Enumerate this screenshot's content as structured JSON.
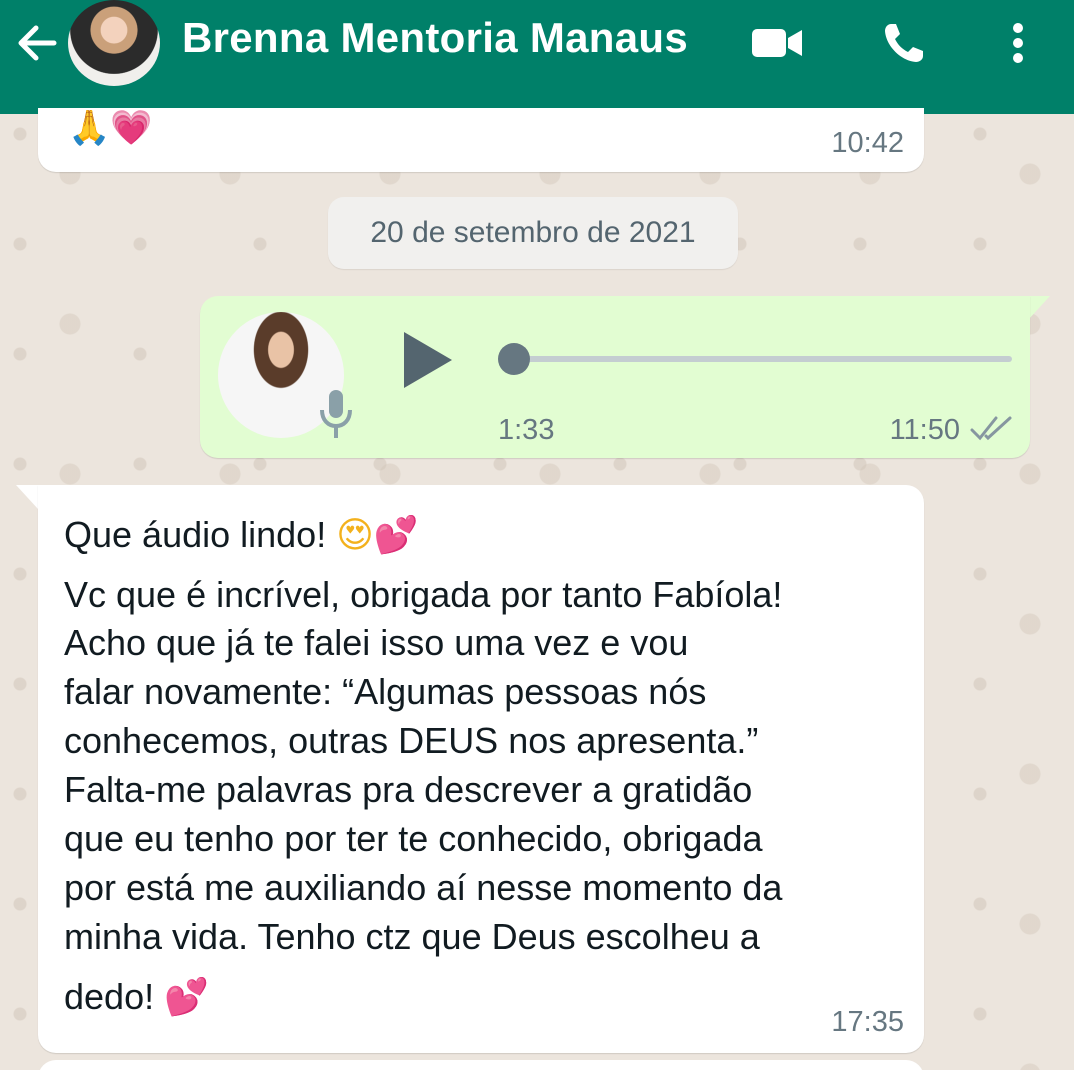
{
  "header": {
    "contact_name": "Brenna Mentoria Manaus",
    "back_icon": "arrow-left-icon",
    "video_icon": "video-camera-icon",
    "call_icon": "phone-icon",
    "menu_icon": "more-vertical-icon",
    "bg_color": "#008069"
  },
  "messages": {
    "previous": {
      "emoji": "🙏💗",
      "time": "10:42"
    },
    "date_separator": "20 de setembro de 2021",
    "audio": {
      "duration": "1:33",
      "time": "11:50",
      "progress": 0.0,
      "status_icon": "double-check-icon",
      "bg_color": "#e2fdd2"
    },
    "text": {
      "lines": [
        "Que áudio lindo! ",
        "Vc que é incrível, obrigada por tanto Fabíola!",
        "Acho que já te falei isso uma vez e vou",
        "falar novamente: “Algumas pessoas nós",
        "conhecemos, outras DEUS nos apresenta.”",
        "Falta-me palavras pra descrever a gratidão",
        "que eu tenho por ter te conhecido, obrigada",
        "por está me auxiliando aí nesse momento da",
        "minha vida. Tenho ctz que Deus escolheu a",
        "dedo! "
      ],
      "emoji_line1_a": "😍",
      "emoji_line1_b": "💕",
      "emoji_last": "💕",
      "time": "17:35"
    }
  }
}
